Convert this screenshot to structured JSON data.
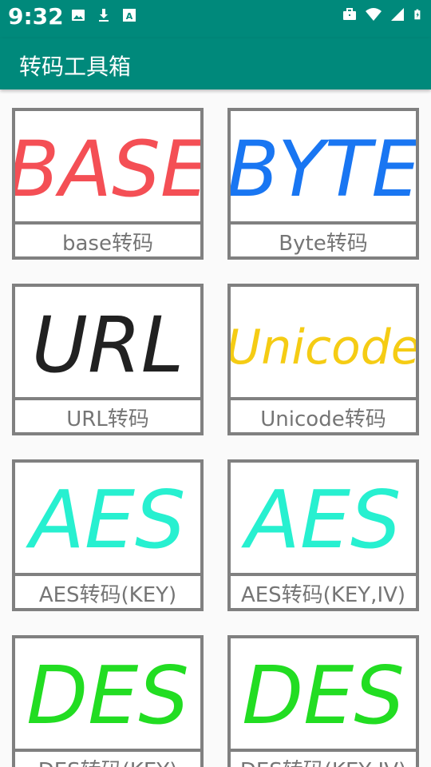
{
  "status_bar": {
    "time": "9:32",
    "left_icons": [
      "image-icon",
      "download-icon",
      "a-box-icon"
    ],
    "right_icons": [
      "briefcase-icon",
      "wifi-icon",
      "signal-icon",
      "battery-icon"
    ]
  },
  "app_bar": {
    "title": "转码工具箱",
    "color": "#00897b"
  },
  "tiles": [
    {
      "art_text": "BASE",
      "art_color": "#f44f55",
      "label": "base转码"
    },
    {
      "art_text": "BYTE",
      "art_color": "#1976f2",
      "label": "Byte转码"
    },
    {
      "art_text": "URL",
      "art_color": "#212121",
      "label": "URL转码"
    },
    {
      "art_text": "Unicode",
      "art_color": "#f5cc14",
      "label": "Unicode转码"
    },
    {
      "art_text": "AES",
      "art_color": "#27f0d0",
      "label": "AES转码(KEY)"
    },
    {
      "art_text": "AES",
      "art_color": "#27f0d0",
      "label": "AES转码(KEY,IV)"
    },
    {
      "art_text": "DES",
      "art_color": "#22dd22",
      "label": "DES转码(KEY)"
    },
    {
      "art_text": "DES",
      "art_color": "#22dd22",
      "label": "DES转码(KEY,IV)"
    }
  ]
}
